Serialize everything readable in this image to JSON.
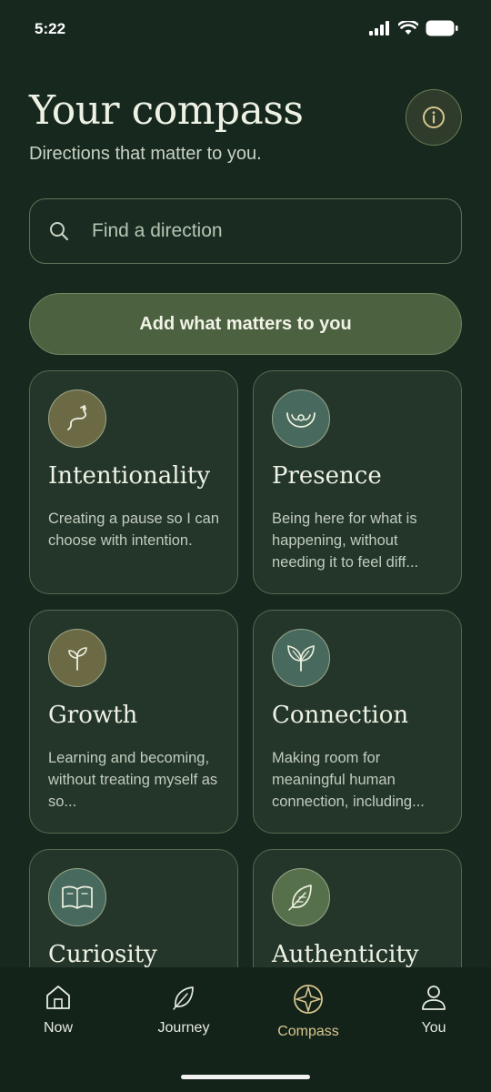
{
  "status": {
    "time": "5:22"
  },
  "header": {
    "title": "Your compass",
    "subtitle": "Directions that matter to you."
  },
  "search": {
    "placeholder": "Find a direction"
  },
  "add_button": {
    "label": "Add what matters to you"
  },
  "cards": [
    {
      "title": "Intentionality",
      "description": "Creating a pause so I can choose with intention.",
      "icon": "path-icon"
    },
    {
      "title": "Presence",
      "description": "Being here for what is happening, without needing it to feel diff...",
      "icon": "hands-icon"
    },
    {
      "title": "Growth",
      "description": "Learning and becoming, without treating myself as so...",
      "icon": "sprout-icon"
    },
    {
      "title": "Connection",
      "description": "Making room for meaningful human connection, including...",
      "icon": "leaves-icon"
    },
    {
      "title": "Curiosity",
      "description": "",
      "icon": "book-icon"
    },
    {
      "title": "Authenticity",
      "description": "",
      "icon": "feather-icon"
    }
  ],
  "tabs": [
    {
      "label": "Now",
      "icon": "home-icon",
      "active": false
    },
    {
      "label": "Journey",
      "icon": "leaf-icon",
      "active": false
    },
    {
      "label": "Compass",
      "icon": "compass-icon",
      "active": true
    },
    {
      "label": "You",
      "icon": "person-icon",
      "active": false
    }
  ],
  "colors": {
    "background": "#17281f",
    "card": "#233629",
    "accent": "#d8c58e",
    "button": "#4c6140"
  }
}
